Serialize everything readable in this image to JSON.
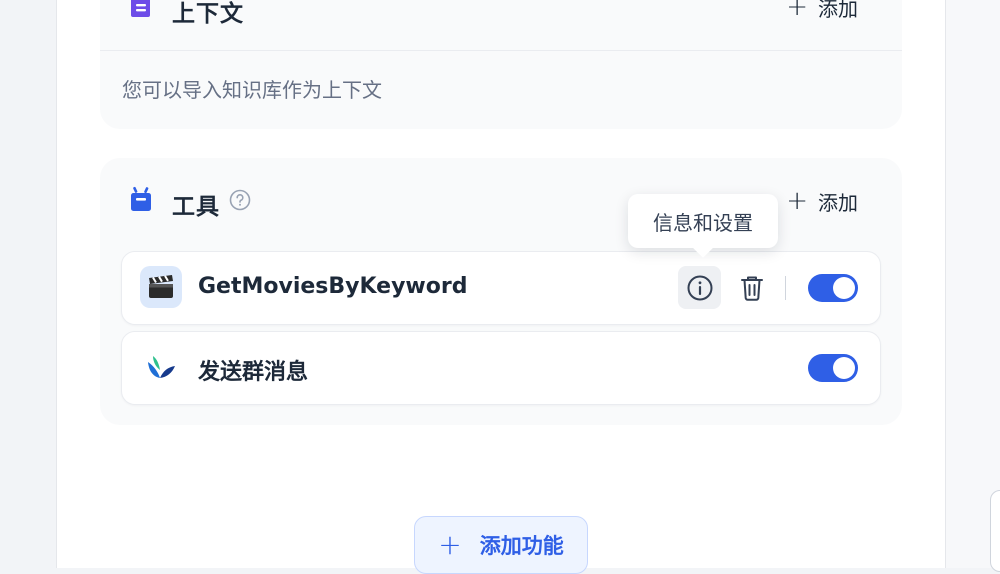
{
  "context": {
    "title": "上下文",
    "add_label": "添加",
    "description": "您可以导入知识库作为上下文",
    "icon": "document-icon"
  },
  "tools": {
    "title": "工具",
    "add_label": "添加",
    "icon": "toolbox-icon",
    "items": [
      {
        "name": "GetMoviesByKeyword",
        "icon": "clapperboard",
        "enabled": true
      },
      {
        "name": "发送群消息",
        "icon": "bird-logo",
        "enabled": true
      }
    ],
    "tooltip": "信息和设置"
  },
  "footer": {
    "add_feature_label": "添加功能"
  },
  "colors": {
    "accent": "#2f5fe6",
    "icon_purple": "#6d4ce8",
    "icon_blue": "#2f5fe6"
  }
}
